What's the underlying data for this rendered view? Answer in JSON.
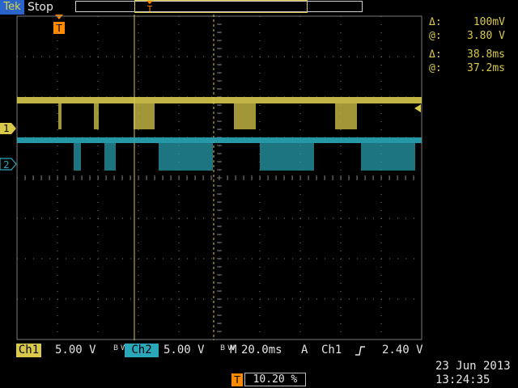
{
  "header": {
    "brand": "Tek",
    "status": "Stop"
  },
  "cursor_readouts": {
    "amplitude": {
      "delta_symbol": "Δ:",
      "delta": "100mV",
      "at_symbol": "@:",
      "at": "3.80 V"
    },
    "time": {
      "delta_symbol": "Δ:",
      "delta": "38.8ms",
      "at_symbol": "@:",
      "at": "37.2ms"
    }
  },
  "channels": {
    "ch1": {
      "label": "Ch1",
      "scale": "5.00 V",
      "marker": "1",
      "color": "#d8c94b"
    },
    "ch2": {
      "label": "Ch2",
      "scale": "5.00 V",
      "marker": "2",
      "color": "#2aa7b8"
    }
  },
  "horizontal": {
    "label": "M",
    "scale": "20.0ms"
  },
  "trigger": {
    "mode": "A",
    "source": "Ch1",
    "slope_icon": "rising-edge-icon",
    "level": "2.40 V",
    "position": "10.20 %",
    "marker": "T"
  },
  "bandwidth_marker": "B W",
  "timestamp": {
    "date": "23 Jun  2013",
    "time": "13:24:35"
  },
  "colors": {
    "ch1": "#d8c94b",
    "ch2": "#2aa7b8",
    "trigger": "#ff8c00",
    "grid": "#7a7a7a",
    "brand": "#2a63c9"
  }
}
